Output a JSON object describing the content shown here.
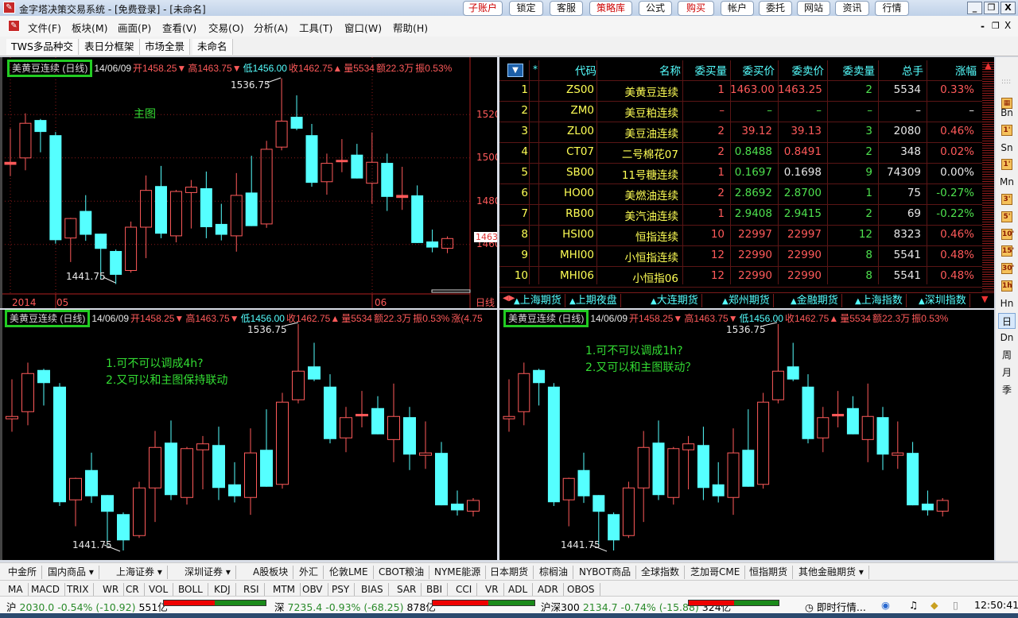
{
  "window": {
    "title": "金字塔决策交易系统 - [免费登录] - [未命名]",
    "title_buttons": [
      {
        "label": "子账户",
        "red": true
      },
      {
        "label": "锁定"
      },
      {
        "label": "客服"
      },
      {
        "label": "策略库",
        "red": true
      },
      {
        "label": "公式"
      },
      {
        "label": "购买",
        "red": true
      },
      {
        "label": "帐户"
      },
      {
        "label": "委托"
      },
      {
        "label": "网站"
      },
      {
        "label": "资讯"
      },
      {
        "label": "行情"
      }
    ],
    "controls": {
      "min": "_",
      "restore": "❐",
      "close": "X"
    }
  },
  "menu": [
    "文件(F)",
    "板块(M)",
    "画面(P)",
    "查看(V)",
    "交易(O)",
    "分析(A)",
    "工具(T)",
    "窗口(W)",
    "帮助(H)"
  ],
  "sub_controls": {
    "min": "-",
    "restore": "❐",
    "close": "X"
  },
  "workspace_tabs": [
    "TWS多品种交",
    "表日分框架",
    "市场全景",
    "未命名"
  ],
  "quote": {
    "name": "美黄豆连续 (日线)",
    "date": "14/06/09",
    "open": "开1458.25▼",
    "high": "高1463.75▼",
    "low": "低1456.00",
    "close": "收1462.75▲",
    "vol": "量5534",
    "amt": "额22.3万",
    "amp": "振0.53%",
    "chg": "涨(4.75",
    "amp_short": "振0.53% 涨"
  },
  "main_chart": {
    "label": "主图",
    "price_ticks": [
      "1520",
      "1500",
      "1480",
      "1460"
    ],
    "last_price": "1463",
    "date_ticks": [
      "2014",
      "05",
      "06"
    ],
    "period": "日线",
    "high_label": "1536.75",
    "low_label": "1441.75"
  },
  "notes": {
    "left": [
      "1.可不可以调成4h?",
      "2.又可以和主图保持联动"
    ],
    "right": [
      "1.可不可以调成1h?",
      "2.又可以和主图联动？"
    ]
  },
  "chart_data": {
    "type": "candlestick",
    "title": "美黄豆连续 (日线)",
    "period": "日线",
    "ohlc": [
      [
        1497,
        1513.6,
        1491.6,
        1498
      ],
      [
        1500,
        1520.6,
        1494.3,
        1516
      ],
      [
        1517.5,
        1518,
        1502.6,
        1512
      ],
      [
        1510.5,
        1512,
        1460.4,
        1462
      ],
      [
        1463,
        1472.3,
        1451.9,
        1472
      ],
      [
        1475.5,
        1482.8,
        1461.7,
        1464.5
      ],
      [
        1465,
        1465,
        1444,
        1458
      ],
      [
        1457,
        1457.7,
        1441.75,
        1446
      ],
      [
        1448,
        1470.6,
        1447,
        1468
      ],
      [
        1468,
        1491.9,
        1453.7,
        1485
      ],
      [
        1487,
        1496.3,
        1462.9,
        1465
      ],
      [
        1464,
        1485.2,
        1461,
        1484.5
      ],
      [
        1484,
        1489.8,
        1467.4,
        1486.5
      ],
      [
        1486,
        1493.7,
        1462.9,
        1468
      ],
      [
        1469.5,
        1478.8,
        1461.9,
        1464.5
      ],
      [
        1464,
        1493,
        1456.7,
        1482.7
      ],
      [
        1484,
        1501,
        1468.5,
        1468.5
      ],
      [
        1469.5,
        1507.9,
        1467.7,
        1504
      ],
      [
        1505,
        1536.75,
        1503.5,
        1517
      ],
      [
        1519,
        1528.9,
        1512.8,
        1513.5
      ],
      [
        1510.5,
        1515.7,
        1486.7,
        1488.5
      ],
      [
        1489,
        1502,
        1483,
        1497.5
      ],
      [
        1498.2,
        1508.7,
        1493.4,
        1498.9
      ],
      [
        1501.5,
        1506.5,
        1490.5,
        1490.5
      ],
      [
        1488.3,
        1511.8,
        1478.8,
        1498
      ],
      [
        1497.7,
        1502,
        1475.5,
        1482
      ],
      [
        1481.7,
        1495.9,
        1476,
        1482.7
      ],
      [
        1482.7,
        1487.3,
        1460.7,
        1460.7
      ],
      [
        1461.4,
        1466.9,
        1456.4,
        1458.6
      ],
      [
        1458.25,
        1463.75,
        1456,
        1462.75
      ]
    ],
    "ylim": [
      1440,
      1540
    ]
  },
  "table": {
    "headers": [
      "代码",
      "名称",
      "委买量",
      "委买价",
      "委卖价",
      "委卖量",
      "总手",
      "涨幅"
    ],
    "star": "*",
    "rows": [
      {
        "n": "1",
        "c": [
          "ZS00",
          "美黄豆连续",
          "1",
          "1463.00",
          "1463.25",
          "2",
          "5534",
          "0.33%"
        ],
        "k": "yyrrrgwr"
      },
      {
        "n": "2",
        "c": [
          "ZM0",
          "美豆粕连续",
          "–",
          "–",
          "–",
          "–",
          "–",
          "–"
        ],
        "k": "yyrgggww"
      },
      {
        "n": "3",
        "c": [
          "ZL00",
          "美豆油连续",
          "2",
          "39.12",
          "39.13",
          "3",
          "2080",
          "0.46%"
        ],
        "k": "yyrrrgwr"
      },
      {
        "n": "4",
        "c": [
          "CT07",
          "二号棉花07",
          "2",
          "0.8488",
          "0.8491",
          "2",
          "348",
          "0.02%"
        ],
        "k": "yyrgrgwr"
      },
      {
        "n": "5",
        "c": [
          "SB00",
          "11号糖连续",
          "1",
          "0.1697",
          "0.1698",
          "9",
          "74309",
          "0.00%"
        ],
        "k": "yyrgwgww"
      },
      {
        "n": "6",
        "c": [
          "HO00",
          "美燃油连续",
          "2",
          "2.8692",
          "2.8700",
          "1",
          "75",
          "-0.27%"
        ],
        "k": "yyrgggwg"
      },
      {
        "n": "7",
        "c": [
          "RB00",
          "美汽油连续",
          "1",
          "2.9408",
          "2.9415",
          "2",
          "69",
          "-0.22%"
        ],
        "k": "yyrgggwg"
      },
      {
        "n": "8",
        "c": [
          "HSI00",
          "恒指连续",
          "10",
          "22997",
          "22997",
          "12",
          "8323",
          "0.46%"
        ],
        "k": "yyrrrgwr"
      },
      {
        "n": "9",
        "c": [
          "MHI00",
          "小恒指连续",
          "12",
          "22990",
          "22990",
          "8",
          "5541",
          "0.48%"
        ],
        "k": "yyrrrgwr"
      },
      {
        "n": "10",
        "c": [
          "MHI06",
          "小恒指06",
          "12",
          "22990",
          "22990",
          "8",
          "5541",
          "0.48%"
        ],
        "k": "yyrrrgwr"
      }
    ],
    "market_tabs": [
      "上海期货",
      "上期夜盘",
      "大连期货",
      "郑州期货",
      "金融期货",
      "上海指数",
      "深圳指数"
    ]
  },
  "period_bar": [
    {
      "t": "Bn"
    },
    {
      "t": "1'",
      "i": 1
    },
    {
      "t": "Sn"
    },
    {
      "t": "1'",
      "i": 1
    },
    {
      "t": "Mn"
    },
    {
      "t": "3'",
      "i": 1
    },
    {
      "t": "5'",
      "i": 1
    },
    {
      "t": "10'",
      "i": 1
    },
    {
      "t": "15'",
      "i": 1
    },
    {
      "t": "30'",
      "i": 1
    },
    {
      "t": "1h",
      "i": 1
    },
    {
      "t": "Hn"
    },
    {
      "t": "日",
      "sel": 1
    },
    {
      "t": "Dn"
    },
    {
      "t": "周"
    },
    {
      "t": "月"
    },
    {
      "t": "季"
    }
  ],
  "market_bar": [
    "中金所",
    "国内商品 ▾",
    "上海证券 ▾",
    "深圳证券 ▾",
    "A股板块",
    "外汇",
    "伦敦LME",
    "CBOT粮油",
    "NYME能源",
    "日本期货",
    "棕榈油",
    "NYBOT商品",
    "全球指数",
    "芝加哥CME",
    "恒指期货",
    "其他金融期货 ▾"
  ],
  "indicator_bar": [
    "MA",
    "MACD",
    "TRIX",
    "WR",
    "CR",
    "VOL",
    "BOLL",
    "KDJ",
    "RSI",
    "MTM",
    "OBV",
    "PSY",
    "BIAS",
    "SAR",
    "BBI",
    "CCI",
    "VR",
    "ADL",
    "ADR",
    "OBOS"
  ],
  "status": {
    "sh": {
      "label": "沪",
      "val": "2030.0 -0.54% (-10.92)",
      "amt": "551亿"
    },
    "sz": {
      "label": "深",
      "val": "7235.4 -0.93% (-68.25)",
      "amt": "878亿"
    },
    "hs300": {
      "label": "沪深300",
      "val": "2134.7 -0.74% (-15.88)",
      "amt": "324亿"
    },
    "realtime": "即时行情...",
    "time": "12:50:41"
  },
  "colors": {
    "up": "#ff5a5a",
    "down": "#55ffff",
    "grid": "#8b1a1a",
    "accent": "#22cc22"
  }
}
